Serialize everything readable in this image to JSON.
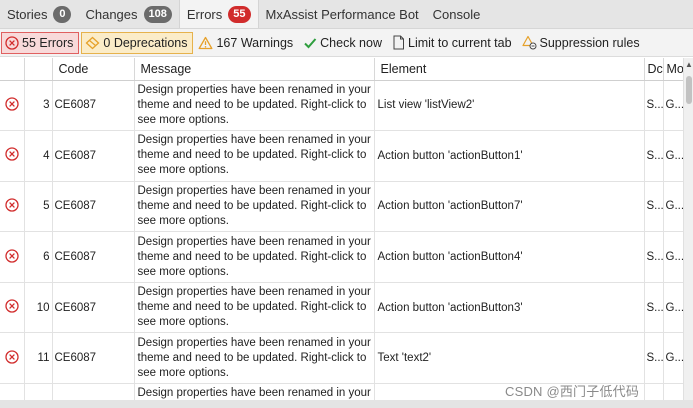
{
  "tabs": [
    {
      "label": "Stories",
      "badge": "0"
    },
    {
      "label": "Changes",
      "badge": "108"
    },
    {
      "label": "Errors",
      "badge": "55"
    },
    {
      "label": "MxAssist Performance Bot"
    },
    {
      "label": "Console"
    }
  ],
  "toolbar": {
    "errors_label": "55 Errors",
    "deprecations_label": "0 Deprecations",
    "warnings_label": "167 Warnings",
    "check_now_label": "Check now",
    "limit_tab_label": "Limit to current tab",
    "suppression_label": "Suppression rules"
  },
  "columns": {
    "code": "Code",
    "message": "Message",
    "element": "Element",
    "doc": "Dc",
    "module": "Mo"
  },
  "rows": [
    {
      "num": "3",
      "code": "CE6087",
      "message": "Design properties have been renamed in your theme and need to be updated. Right-click to see more options.",
      "element": "List view 'listView2'",
      "doc": "S...",
      "module": "G..."
    },
    {
      "num": "4",
      "code": "CE6087",
      "message": "Design properties have been renamed in your theme and need to be updated. Right-click to see more options.",
      "element": "Action button 'actionButton1'",
      "doc": "S...",
      "module": "G..."
    },
    {
      "num": "5",
      "code": "CE6087",
      "message": "Design properties have been renamed in your theme and need to be updated. Right-click to see more options.",
      "element": "Action button 'actionButton7'",
      "doc": "S...",
      "module": "G..."
    },
    {
      "num": "6",
      "code": "CE6087",
      "message": "Design properties have been renamed in your theme and need to be updated. Right-click to see more options.",
      "element": "Action button 'actionButton4'",
      "doc": "S...",
      "module": "G..."
    },
    {
      "num": "10",
      "code": "CE6087",
      "message": "Design properties have been renamed in your theme and need to be updated. Right-click to see more options.",
      "element": "Action button 'actionButton3'",
      "doc": "S...",
      "module": "G..."
    },
    {
      "num": "11",
      "code": "CE6087",
      "message": "Design properties have been renamed in your theme and need to be updated. Right-click to see more options.",
      "element": "Text 'text2'",
      "doc": "S...",
      "module": "G..."
    }
  ],
  "partial_row": {
    "message": "Design properties have been renamed in your"
  },
  "watermark": "CSDN @西门子低代码",
  "colors": {
    "error_red": "#d12c2c",
    "warning_amber": "#e6a12a",
    "check_green": "#2e9e3e"
  },
  "icons": [
    "error-icon",
    "deprecation-icon",
    "warning-icon",
    "checkmark-icon",
    "document-icon",
    "suppression-icon"
  ]
}
